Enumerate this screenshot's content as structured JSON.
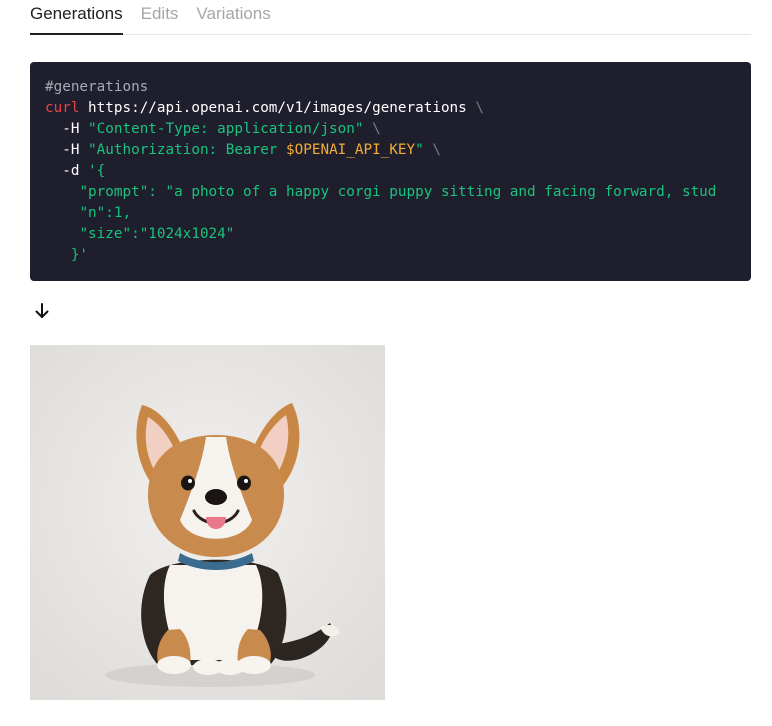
{
  "tabs": [
    {
      "label": "Generations",
      "active": true
    },
    {
      "label": "Edits",
      "active": false
    },
    {
      "label": "Variations",
      "active": false
    }
  ],
  "code": {
    "comment": "#generations",
    "cmd": "curl",
    "url": "https://api.openai.com/v1/images/generations",
    "continuation": "\\",
    "header_flag": "-H",
    "content_type": "\"Content-Type: application/json\"",
    "auth_prefix": "\"Authorization: Bearer ",
    "api_key_var": "$OPENAI_API_KEY",
    "auth_suffix": "\"",
    "data_flag": "-d",
    "data_open": "'{",
    "prompt_line": "\"prompt\": \"a photo of a happy corgi puppy sitting and facing forward, stud",
    "n_line": "\"n\":1,",
    "size_line": "\"size\":\"1024x1024\"",
    "data_close": "}'"
  },
  "arrow_icon": "arrow-down-icon",
  "image": {
    "subject": "corgi-puppy-photo"
  },
  "colors": {
    "code_bg": "#1e1e2d",
    "keyword": "#ef4146",
    "string": "#19c37d",
    "variable": "#f4ac36",
    "active_tab": "#202123",
    "inactive_tab": "#a6a6a6"
  }
}
